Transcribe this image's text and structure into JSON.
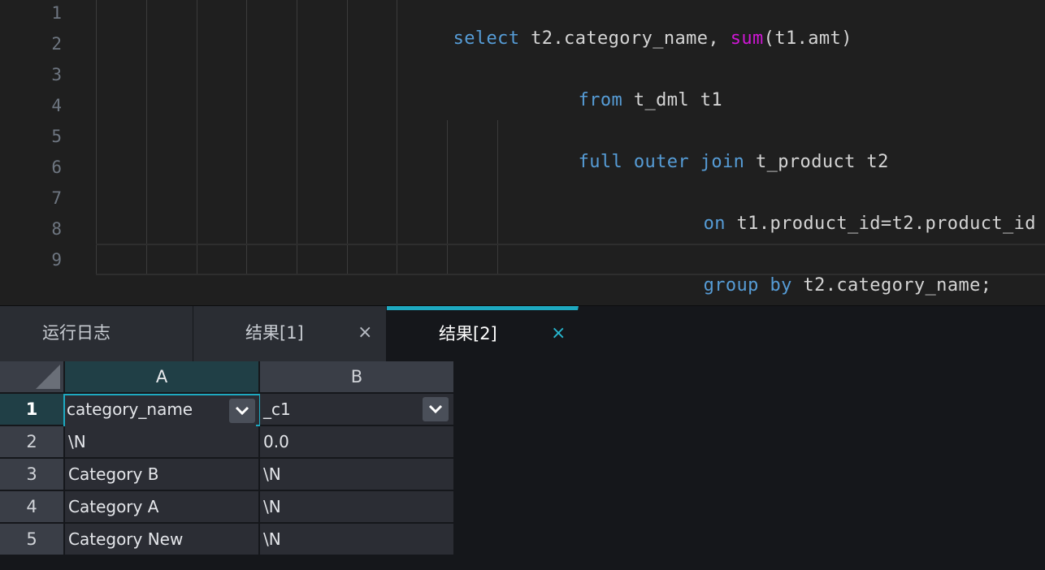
{
  "editor": {
    "line_numbers": [
      "1",
      "2",
      "3",
      "4",
      "5",
      "6",
      "7",
      "8",
      "9"
    ],
    "line1": {
      "kw1": "select",
      "t1": " t2.category_name, ",
      "fn": "sum",
      "t2": "(t1.amt)"
    },
    "line3": {
      "kw1": "from",
      "t1": " t_dml t1"
    },
    "line5": {
      "kw1": "full",
      "sp1": " ",
      "kw2": "outer",
      "sp2": " ",
      "kw3": "join",
      "t1": " t_product t2"
    },
    "line7": {
      "kw1": "on",
      "t1": " t1.product_id=t2.product_id"
    },
    "line9": {
      "kw1": "group",
      "sp1": " ",
      "kw2": "by",
      "t1": " t2.category_name;"
    }
  },
  "tabs": [
    {
      "label": "运行日志"
    },
    {
      "label": "结果[1]",
      "close": "×"
    },
    {
      "label": "结果[2]",
      "close": "×"
    }
  ],
  "grid": {
    "columns": [
      "A",
      "B"
    ],
    "rows": [
      {
        "num": "1",
        "a": "category_name",
        "b": "_c1"
      },
      {
        "num": "2",
        "a": "\\N",
        "b": "0.0"
      },
      {
        "num": "3",
        "a": "Category B",
        "b": "\\N"
      },
      {
        "num": "4",
        "a": "Category A",
        "b": "\\N"
      },
      {
        "num": "5",
        "a": "Category New",
        "b": "\\N"
      }
    ]
  },
  "colors": {
    "keyword": "#569cd6",
    "function": "#d016d6",
    "accent": "#1ea9c0"
  }
}
